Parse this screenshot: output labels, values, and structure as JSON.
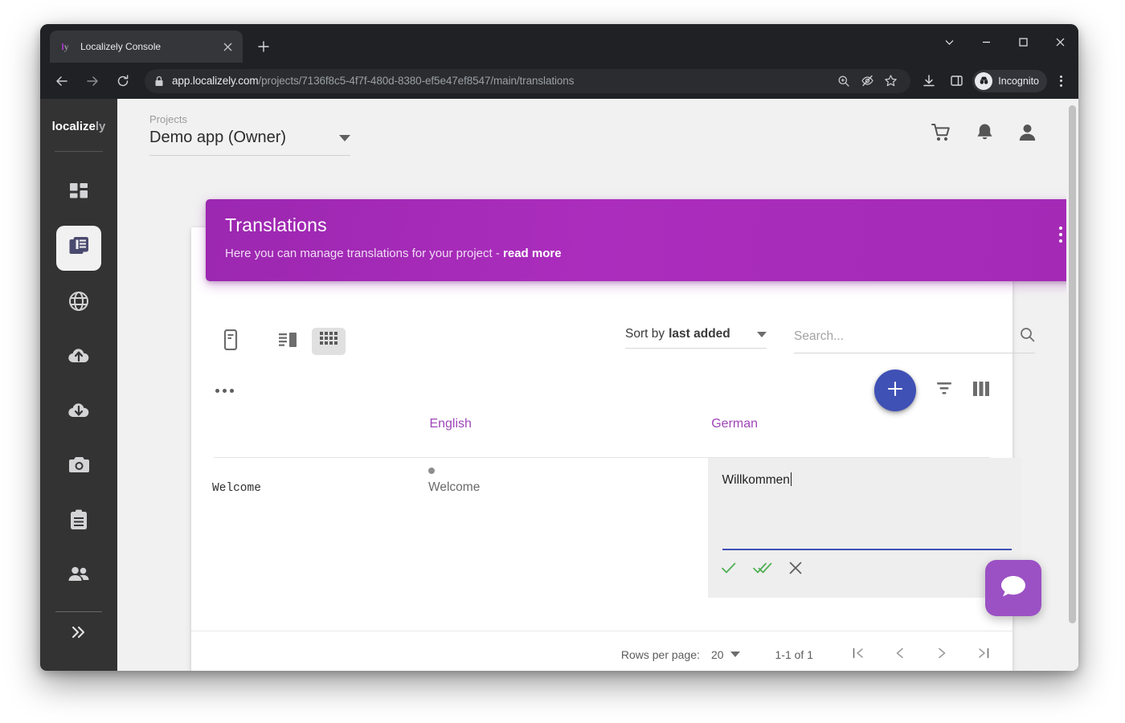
{
  "browser": {
    "tab": {
      "favicon_primary": "l",
      "favicon_secondary": "y",
      "title": "Localizely Console",
      "close_icon": "close-icon"
    },
    "new_tab_label": "+",
    "window_controls": [
      "chevron-down-icon",
      "minimize-icon",
      "maximize-icon",
      "close-icon"
    ],
    "url": {
      "host": "app.localizely.com",
      "path": "/projects/7136f8c5-4f7f-480d-8380-ef5e47ef8547/main/translations"
    },
    "omni_icons": [
      "zoom-in-icon",
      "eye-slash-icon",
      "star-icon"
    ],
    "toolbar_icons": [
      "download-icon",
      "side-panel-icon"
    ],
    "profile_chip": "Incognito",
    "nav": [
      "back-icon",
      "forward-icon",
      "reload-icon"
    ]
  },
  "sidebar": {
    "brand_primary": "localize",
    "brand_secondary": "ly",
    "items": [
      {
        "name": "dashboard",
        "icon": "grid-icon",
        "active": false
      },
      {
        "name": "translations",
        "icon": "documents-icon",
        "active": true
      },
      {
        "name": "languages",
        "icon": "globe-icon",
        "active": false
      },
      {
        "name": "upload",
        "icon": "cloud-upload-icon",
        "active": false
      },
      {
        "name": "download",
        "icon": "cloud-download-icon",
        "active": false
      },
      {
        "name": "screenshots",
        "icon": "camera-icon",
        "active": false
      },
      {
        "name": "orders",
        "icon": "clipboard-icon",
        "active": false
      },
      {
        "name": "team",
        "icon": "people-icon",
        "active": false
      }
    ],
    "expand_label": "»"
  },
  "header": {
    "projects_label": "Projects",
    "project_name": "Demo app (Owner)",
    "icons": [
      "cart-icon",
      "bell-icon",
      "account-icon"
    ]
  },
  "banner": {
    "title": "Translations",
    "description": "Here you can manage translations for your project - ",
    "link": "read more",
    "menu_icon": "more-vertical-icon",
    "color": "#9c27b0"
  },
  "toolbar": {
    "views": [
      {
        "name": "single-view",
        "icon": "phone-icon",
        "selected": false
      },
      {
        "name": "list-view",
        "icon": "split-list-icon",
        "selected": false
      },
      {
        "name": "grid-view",
        "icon": "grid-table-icon",
        "selected": true
      }
    ],
    "sort_prefix": "Sort by",
    "sort_value": "last added",
    "search_placeholder": "Search...",
    "search_value": "",
    "search_icon": "search-icon"
  },
  "actions": {
    "more_icon": "more-horizontal-icon",
    "add_icon": "plus-icon",
    "add_color": "#3f51b5",
    "filter_icon": "filter-icon",
    "columns_icon": "columns-icon"
  },
  "table": {
    "columns": [
      {
        "key": "key",
        "label": ""
      },
      {
        "key": "english",
        "label": "English"
      },
      {
        "key": "german",
        "label": "German"
      }
    ],
    "rows": [
      {
        "key": "Welcome",
        "english": {
          "value": "Welcome",
          "status": "unreviewed"
        },
        "german": {
          "value": "Willkommen",
          "editing": true
        }
      }
    ],
    "edit_actions": [
      {
        "name": "approve",
        "icon": "check-icon",
        "color": "#4caf50"
      },
      {
        "name": "approve-and-next",
        "icon": "double-check-icon",
        "color": "#4caf50"
      },
      {
        "name": "cancel",
        "icon": "close-icon",
        "color": "#5e5e5e"
      }
    ]
  },
  "footer": {
    "rows_per_page_label": "Rows per page:",
    "rows_per_page_value": "20",
    "range_label": "1-1 of 1",
    "pager": [
      "first-page-icon",
      "previous-page-icon",
      "next-page-icon",
      "last-page-icon"
    ]
  },
  "chat": {
    "icon": "chat-bubble-icon",
    "color": "#9b51c4"
  }
}
